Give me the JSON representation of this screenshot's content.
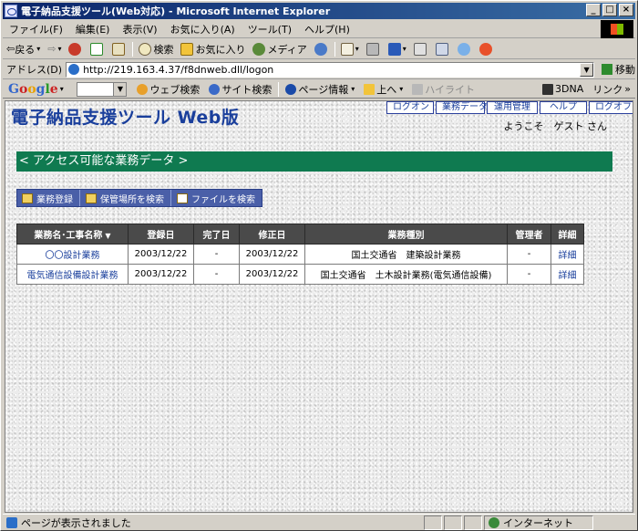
{
  "window": {
    "title": "電子納品支援ツール(Web対応) - Microsoft Internet Explorer",
    "controls": {
      "minimize": "_",
      "maximize": "□",
      "close": "×"
    }
  },
  "menu": [
    "ファイル(F)",
    "編集(E)",
    "表示(V)",
    "お気に入り(A)",
    "ツール(T)",
    "ヘルプ(H)"
  ],
  "toolbar": {
    "back": "戻る",
    "search": "検索",
    "favorites": "お気に入り",
    "media": "メディア"
  },
  "address": {
    "label": "アドレス(D)",
    "url": "http://219.163.4.37/f8dnweb.dll/logon",
    "go": "移動"
  },
  "google_bar": {
    "logo": "Google",
    "web_search": "ウェブ検索",
    "site_search": "サイト検索",
    "page_info": "ページ情報",
    "up": "上へ",
    "highlight": "ハイライト",
    "threedna": "3DNA",
    "links": "リンク"
  },
  "page": {
    "site_title": "電子納品支援ツール Web版",
    "nav": [
      "ログオン",
      "業務データ",
      "運用管理",
      "ヘルプ",
      "ログオフ"
    ],
    "welcome": "ようこそ　ゲスト さん",
    "section_title": "< アクセス可能な業務データ >",
    "actions": [
      "業務登録",
      "保管場所を検索",
      "ファイルを検索"
    ]
  },
  "table": {
    "headers": [
      "業務名･工事名称",
      "登録日",
      "完了日",
      "修正日",
      "業務種別",
      "管理者",
      "詳細"
    ],
    "sort_indicator": "▼",
    "rows": [
      [
        "〇〇設計業務",
        "2003/12/22",
        "-",
        "2003/12/22",
        "国土交通省　建築設計業務",
        "-",
        "詳細"
      ],
      [
        "電気通信設備設計業務",
        "2003/12/22",
        "-",
        "2003/12/22",
        "国土交通省　土木設計業務(電気通信設備)",
        "-",
        "詳細"
      ]
    ]
  },
  "status": {
    "text": "ページが表示されました",
    "zone": "インターネット"
  }
}
